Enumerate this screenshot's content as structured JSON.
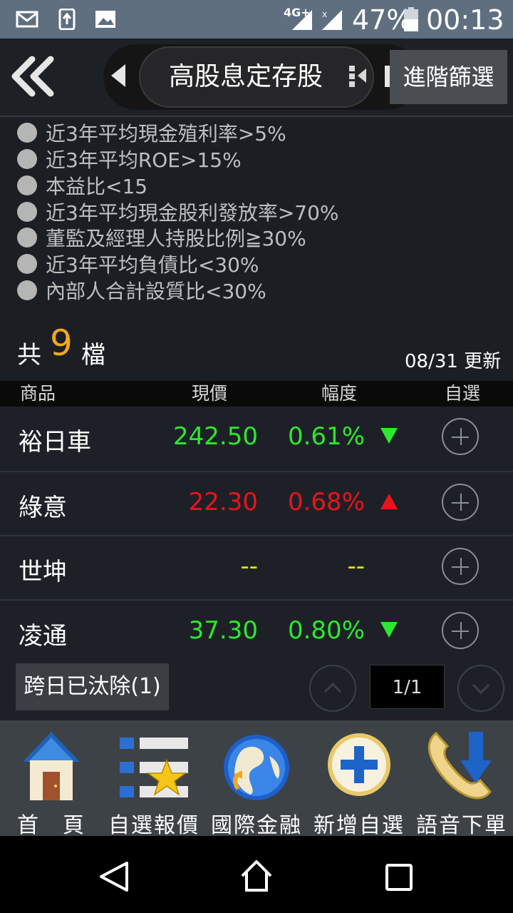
{
  "status_bar": {
    "network": "4G+",
    "battery": "47%",
    "time": "00:13"
  },
  "header": {
    "title": "高股息定存股",
    "advanced_filter_label": "進階篩選"
  },
  "criteria": [
    "近3年平均現金殖利率>5%",
    "近3年平均ROE>15%",
    "本益比<15",
    "近3年平均現金股利發放率>70%",
    "董監及經理人持股比例≧30%",
    "近3年平均負債比<30%",
    "內部人合計設質比<30%"
  ],
  "summary": {
    "prefix": "共",
    "count": "9",
    "suffix": "檔",
    "update_text": "08/31 更新"
  },
  "table": {
    "columns": [
      "商品",
      "現價",
      "幅度",
      "自選"
    ],
    "rows": [
      {
        "name": "裕日車",
        "price": "242.50",
        "change": "0.61%",
        "direction": "down",
        "color": "#2ee82e"
      },
      {
        "name": "綠意",
        "price": "22.30",
        "change": "0.68%",
        "direction": "up",
        "color": "#e8141b"
      },
      {
        "name": "世坤",
        "price": "--",
        "change": "--",
        "direction": "none",
        "color": "#e8e800"
      },
      {
        "name": "凌通",
        "price": "37.30",
        "change": "0.80%",
        "direction": "down",
        "color": "#2ee82e"
      }
    ]
  },
  "pager": {
    "removed_label": "跨日已汰除(1)",
    "page_text": "1/1"
  },
  "bottom_nav": [
    {
      "label": "首　頁",
      "icon": "home-icon"
    },
    {
      "label": "自選報價",
      "icon": "watchlist-icon"
    },
    {
      "label": "國際金融",
      "icon": "globe-icon"
    },
    {
      "label": "新增自選",
      "icon": "add-icon"
    },
    {
      "label": "語音下單",
      "icon": "phone-icon"
    }
  ],
  "colors": {
    "up": "#e8141b",
    "down": "#2ee82e",
    "flat": "#e8e800",
    "accent": "#f0a81c"
  }
}
